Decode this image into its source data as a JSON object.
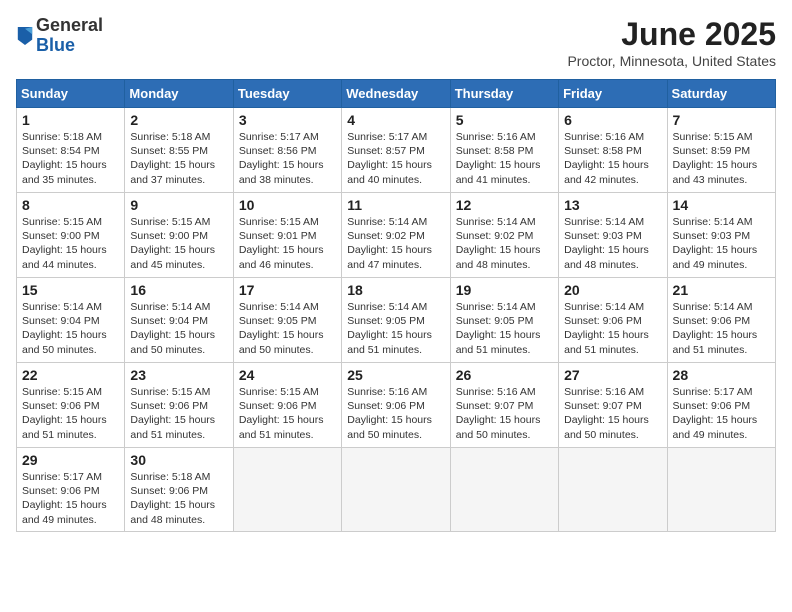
{
  "header": {
    "logo_general": "General",
    "logo_blue": "Blue",
    "month_title": "June 2025",
    "location": "Proctor, Minnesota, United States"
  },
  "calendar": {
    "days_of_week": [
      "Sunday",
      "Monday",
      "Tuesday",
      "Wednesday",
      "Thursday",
      "Friday",
      "Saturday"
    ],
    "weeks": [
      [
        {
          "day": "1",
          "sunrise": "5:18 AM",
          "sunset": "8:54 PM",
          "daylight": "15 hours and 35 minutes."
        },
        {
          "day": "2",
          "sunrise": "5:18 AM",
          "sunset": "8:55 PM",
          "daylight": "15 hours and 37 minutes."
        },
        {
          "day": "3",
          "sunrise": "5:17 AM",
          "sunset": "8:56 PM",
          "daylight": "15 hours and 38 minutes."
        },
        {
          "day": "4",
          "sunrise": "5:17 AM",
          "sunset": "8:57 PM",
          "daylight": "15 hours and 40 minutes."
        },
        {
          "day": "5",
          "sunrise": "5:16 AM",
          "sunset": "8:58 PM",
          "daylight": "15 hours and 41 minutes."
        },
        {
          "day": "6",
          "sunrise": "5:16 AM",
          "sunset": "8:58 PM",
          "daylight": "15 hours and 42 minutes."
        },
        {
          "day": "7",
          "sunrise": "5:15 AM",
          "sunset": "8:59 PM",
          "daylight": "15 hours and 43 minutes."
        }
      ],
      [
        {
          "day": "8",
          "sunrise": "5:15 AM",
          "sunset": "9:00 PM",
          "daylight": "15 hours and 44 minutes."
        },
        {
          "day": "9",
          "sunrise": "5:15 AM",
          "sunset": "9:00 PM",
          "daylight": "15 hours and 45 minutes."
        },
        {
          "day": "10",
          "sunrise": "5:15 AM",
          "sunset": "9:01 PM",
          "daylight": "15 hours and 46 minutes."
        },
        {
          "day": "11",
          "sunrise": "5:14 AM",
          "sunset": "9:02 PM",
          "daylight": "15 hours and 47 minutes."
        },
        {
          "day": "12",
          "sunrise": "5:14 AM",
          "sunset": "9:02 PM",
          "daylight": "15 hours and 48 minutes."
        },
        {
          "day": "13",
          "sunrise": "5:14 AM",
          "sunset": "9:03 PM",
          "daylight": "15 hours and 48 minutes."
        },
        {
          "day": "14",
          "sunrise": "5:14 AM",
          "sunset": "9:03 PM",
          "daylight": "15 hours and 49 minutes."
        }
      ],
      [
        {
          "day": "15",
          "sunrise": "5:14 AM",
          "sunset": "9:04 PM",
          "daylight": "15 hours and 50 minutes."
        },
        {
          "day": "16",
          "sunrise": "5:14 AM",
          "sunset": "9:04 PM",
          "daylight": "15 hours and 50 minutes."
        },
        {
          "day": "17",
          "sunrise": "5:14 AM",
          "sunset": "9:05 PM",
          "daylight": "15 hours and 50 minutes."
        },
        {
          "day": "18",
          "sunrise": "5:14 AM",
          "sunset": "9:05 PM",
          "daylight": "15 hours and 51 minutes."
        },
        {
          "day": "19",
          "sunrise": "5:14 AM",
          "sunset": "9:05 PM",
          "daylight": "15 hours and 51 minutes."
        },
        {
          "day": "20",
          "sunrise": "5:14 AM",
          "sunset": "9:06 PM",
          "daylight": "15 hours and 51 minutes."
        },
        {
          "day": "21",
          "sunrise": "5:14 AM",
          "sunset": "9:06 PM",
          "daylight": "15 hours and 51 minutes."
        }
      ],
      [
        {
          "day": "22",
          "sunrise": "5:15 AM",
          "sunset": "9:06 PM",
          "daylight": "15 hours and 51 minutes."
        },
        {
          "day": "23",
          "sunrise": "5:15 AM",
          "sunset": "9:06 PM",
          "daylight": "15 hours and 51 minutes."
        },
        {
          "day": "24",
          "sunrise": "5:15 AM",
          "sunset": "9:06 PM",
          "daylight": "15 hours and 51 minutes."
        },
        {
          "day": "25",
          "sunrise": "5:16 AM",
          "sunset": "9:06 PM",
          "daylight": "15 hours and 50 minutes."
        },
        {
          "day": "26",
          "sunrise": "5:16 AM",
          "sunset": "9:07 PM",
          "daylight": "15 hours and 50 minutes."
        },
        {
          "day": "27",
          "sunrise": "5:16 AM",
          "sunset": "9:07 PM",
          "daylight": "15 hours and 50 minutes."
        },
        {
          "day": "28",
          "sunrise": "5:17 AM",
          "sunset": "9:06 PM",
          "daylight": "15 hours and 49 minutes."
        }
      ],
      [
        {
          "day": "29",
          "sunrise": "5:17 AM",
          "sunset": "9:06 PM",
          "daylight": "15 hours and 49 minutes."
        },
        {
          "day": "30",
          "sunrise": "5:18 AM",
          "sunset": "9:06 PM",
          "daylight": "15 hours and 48 minutes."
        },
        null,
        null,
        null,
        null,
        null
      ]
    ]
  }
}
